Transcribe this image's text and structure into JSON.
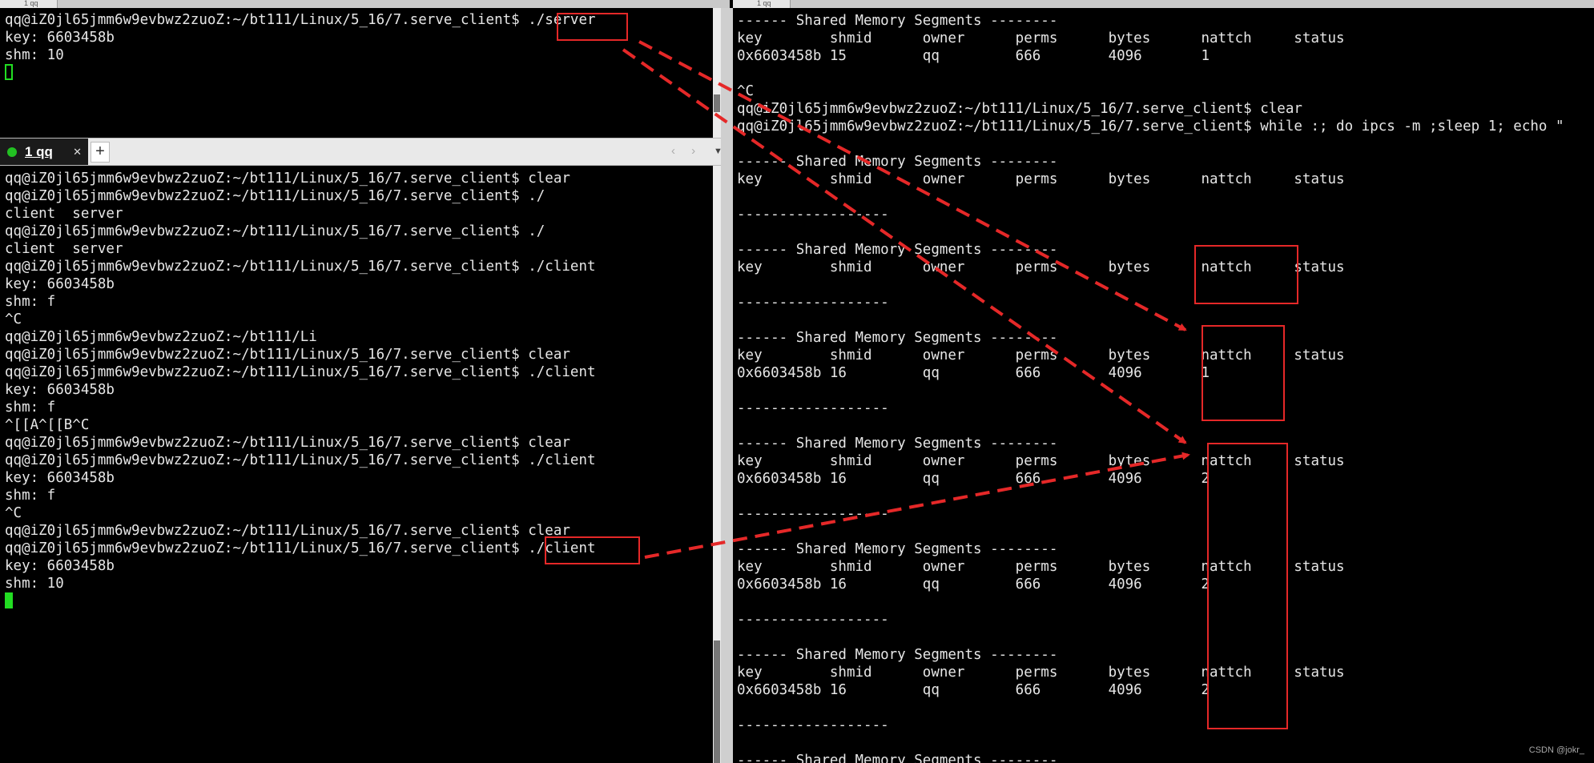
{
  "top_left_terminal": {
    "lines": [
      "qq@iZ0jl65jmm6w9evbwz2zuoZ:~/bt111/Linux/5_16/7.serve_client$ ./server",
      "key: 6603458b",
      "shm: 10"
    ]
  },
  "tab_bar": {
    "active_tab_label": "1 qq",
    "close_glyph": "✕",
    "new_tab_glyph": "+",
    "nav_arrows": "‹ ›",
    "menu_glyph": "▼"
  },
  "bottom_left_terminal": {
    "lines": [
      "qq@iZ0jl65jmm6w9evbwz2zuoZ:~/bt111/Linux/5_16/7.serve_client$ clear",
      "qq@iZ0jl65jmm6w9evbwz2zuoZ:~/bt111/Linux/5_16/7.serve_client$ ./",
      "client  server",
      "qq@iZ0jl65jmm6w9evbwz2zuoZ:~/bt111/Linux/5_16/7.serve_client$ ./",
      "client  server",
      "qq@iZ0jl65jmm6w9evbwz2zuoZ:~/bt111/Linux/5_16/7.serve_client$ ./client",
      "key: 6603458b",
      "shm: f",
      "^C",
      "qq@iZ0jl65jmm6w9evbwz2zuoZ:~/bt111/Li",
      "qq@iZ0jl65jmm6w9evbwz2zuoZ:~/bt111/Linux/5_16/7.serve_client$ clear",
      "qq@iZ0jl65jmm6w9evbwz2zuoZ:~/bt111/Linux/5_16/7.serve_client$ ./client",
      "key: 6603458b",
      "shm: f",
      "^[[A^[[B^C",
      "qq@iZ0jl65jmm6w9evbwz2zuoZ:~/bt111/Linux/5_16/7.serve_client$ clear",
      "qq@iZ0jl65jmm6w9evbwz2zuoZ:~/bt111/Linux/5_16/7.serve_client$ ./client",
      "key: 6603458b",
      "shm: f",
      "^C",
      "qq@iZ0jl65jmm6w9evbwz2zuoZ:~/bt111/Linux/5_16/7.serve_client$ clear",
      "qq@iZ0jl65jmm6w9evbwz2zuoZ:~/bt111/Linux/5_16/7.serve_client$ ./client",
      "key: 6603458b",
      "shm: 10"
    ]
  },
  "right_terminal": {
    "lines": [
      "------ Shared Memory Segments --------",
      "key        shmid      owner      perms      bytes      nattch     status",
      "0x6603458b 15         qq         666        4096       1",
      "",
      "^C",
      "qq@iZ0jl65jmm6w9evbwz2zuoZ:~/bt111/Linux/5_16/7.serve_client$ clear",
      "qq@iZ0jl65jmm6w9evbwz2zuoZ:~/bt111/Linux/5_16/7.serve_client$ while :; do ipcs -m ;sleep 1; echo \"",
      "",
      "------ Shared Memory Segments --------",
      "key        shmid      owner      perms      bytes      nattch     status",
      "",
      "------------------",
      "",
      "------ Shared Memory Segments --------",
      "key        shmid      owner      perms      bytes      nattch     status",
      "",
      "------------------",
      "",
      "------ Shared Memory Segments --------",
      "key        shmid      owner      perms      bytes      nattch     status",
      "0x6603458b 16         qq         666        4096       1",
      "",
      "------------------",
      "",
      "------ Shared Memory Segments --------",
      "key        shmid      owner      perms      bytes      nattch     status",
      "0x6603458b 16         qq         666        4096       2",
      "",
      "------------------",
      "",
      "------ Shared Memory Segments --------",
      "key        shmid      owner      perms      bytes      nattch     status",
      "0x6603458b 16         qq         666        4096       2",
      "",
      "------------------",
      "",
      "------ Shared Memory Segments --------",
      "key        shmid      owner      perms      bytes      nattch     status",
      "0x6603458b 16         qq         666        4096       2",
      "",
      "------------------",
      "",
      "------ Shared Memory Segments --------"
    ]
  },
  "top_strip_tabs": [
    "1 qq",
    "1 qq"
  ],
  "watermark": "CSDN @jokr_",
  "colors": {
    "terminal_background": "#000000",
    "terminal_text": "#e6e6e6",
    "cursor": "#22dd22",
    "annotation": "#e52828",
    "tab_active": "#1b1b1b",
    "session_dot": "#22c022"
  }
}
